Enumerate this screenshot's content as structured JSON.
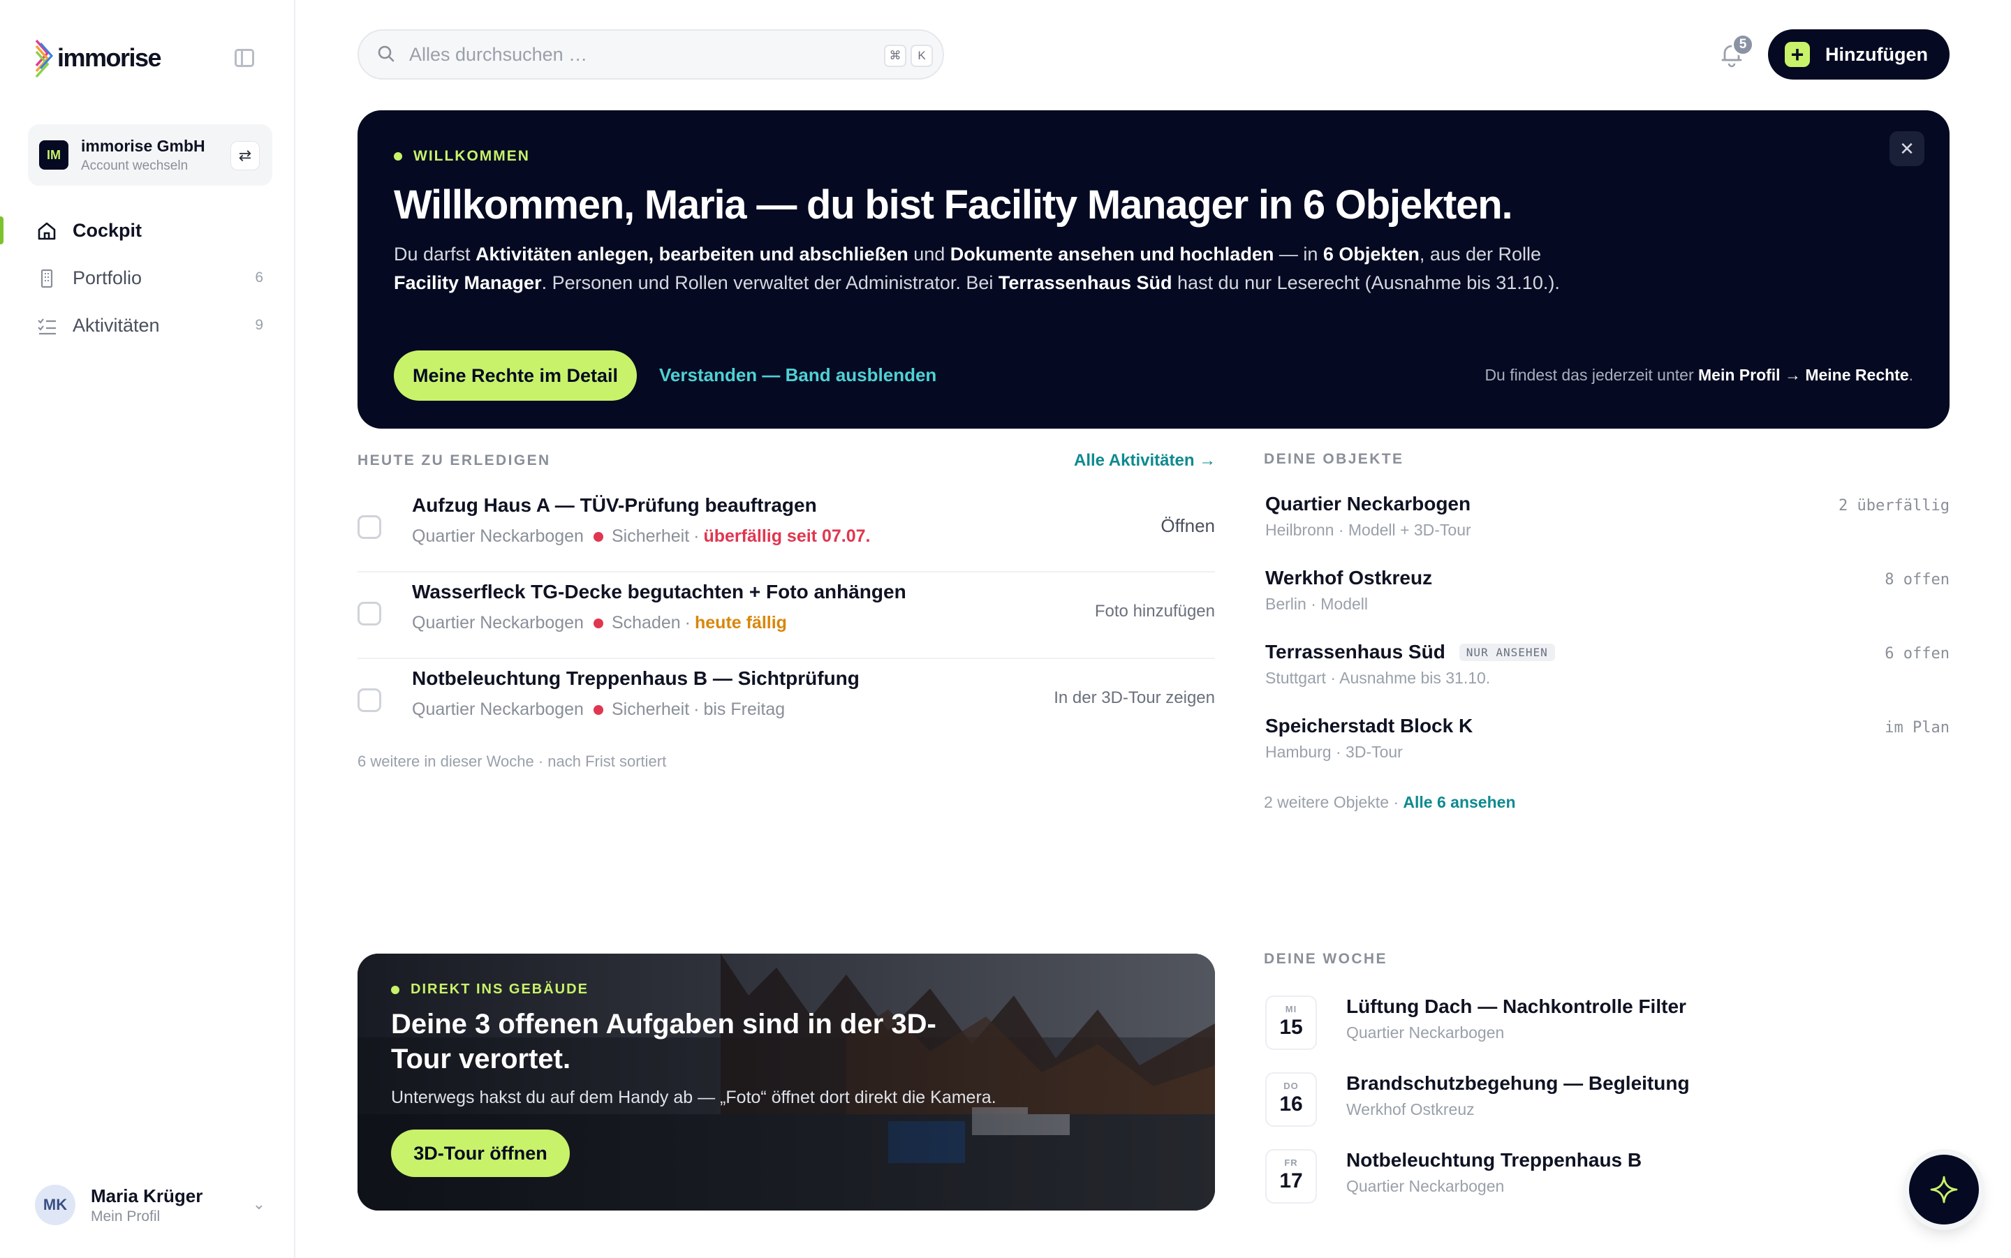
{
  "brand": {
    "name": "immorise"
  },
  "account": {
    "initials": "IM",
    "name": "immorise GmbH",
    "sub": "Account wechseln"
  },
  "nav": [
    {
      "label": "Cockpit",
      "count": ""
    },
    {
      "label": "Portfolio",
      "count": "6"
    },
    {
      "label": "Aktivitäten",
      "count": "9"
    }
  ],
  "user": {
    "initials": "MK",
    "name": "Maria Krüger",
    "sub": "Mein Profil"
  },
  "search": {
    "placeholder": "Alles durchsuchen …",
    "kbd_1": "⌘",
    "kbd_2": "K"
  },
  "notifications": {
    "count": "5"
  },
  "add_button": {
    "label": "Hinzufügen"
  },
  "banner": {
    "eyebrow": "WILLKOMMEN",
    "title": "Willkommen, Maria — du bist Facility Manager in 6 Objekten.",
    "text_1": "Du darfst ",
    "text_b1": "Aktivitäten anlegen, bearbeiten und abschließen",
    "text_2": " und ",
    "text_b2": "Dokumente ansehen und hochladen",
    "text_3": " — in ",
    "text_b3": "6 Objekten",
    "text_4": ", aus der Rolle ",
    "text_b4": "Facility Manager",
    "text_5": ". Personen und Rollen verwaltet der Administrator. Bei ",
    "text_b5": "Terrassenhaus Süd",
    "text_6": " hast du nur Leserecht (Ausnahme bis 31.10.).",
    "primary_button": "Meine Rechte im Detail",
    "dismiss_link": "Verstanden — Band ausblenden",
    "hint_prefix": "Du findest das jederzeit unter ",
    "hint_path": "Mein Profil → Meine Rechte",
    "hint_suffix": "."
  },
  "today": {
    "label": "HEUTE ZU ERLEDIGEN",
    "link": "Alle Aktivitäten →",
    "tasks": [
      {
        "title": "Aufzug Haus A — TÜV-Prüfung beauftragen",
        "object": "Quartier Neckarbogen",
        "category": "Sicherheit",
        "due": "überfällig seit 07.07.",
        "action": "Öffnen"
      },
      {
        "title": "Wasserfleck TG-Decke begutachten + Foto anhängen",
        "object": "Quartier Neckarbogen",
        "category": "Schaden",
        "due": "heute fällig",
        "action": "Foto hinzufügen"
      },
      {
        "title": "Notbeleuchtung Treppenhaus B — Sichtprüfung",
        "object": "Quartier Neckarbogen",
        "category": "Sicherheit",
        "due": "bis Freitag",
        "action": "In der 3D-Tour zeigen"
      }
    ],
    "footer": "6 weitere in dieser Woche · nach Frist sortiert"
  },
  "objects": {
    "label": "DEINE OBJEKTE",
    "items": [
      {
        "name": "Quartier Neckarbogen",
        "tag": "",
        "sub": "Heilbronn · Modell + 3D-Tour",
        "stat": "2 überfällig"
      },
      {
        "name": "Werkhof Ostkreuz",
        "tag": "",
        "sub": "Berlin · Modell",
        "stat": "8 offen"
      },
      {
        "name": "Terrassenhaus Süd",
        "tag": "NUR ANSEHEN",
        "sub": "Stuttgart · Ausnahme bis 31.10.",
        "stat": "6 offen"
      },
      {
        "name": "Speicherstadt Block K",
        "tag": "",
        "sub": "Hamburg · 3D-Tour",
        "stat": "im Plan"
      }
    ],
    "footer_text": "2 weitere Objekte · ",
    "footer_link": "Alle 6 ansehen"
  },
  "tour": {
    "eyebrow": "DIREKT INS GEBÄUDE",
    "title": "Deine 3 offenen Aufgaben sind in der 3D-Tour verortet.",
    "text": "Unterwegs hakst du auf dem Handy ab — „Foto“ öffnet dort direkt die Kamera.",
    "button": "3D-Tour öffnen"
  },
  "week": {
    "label": "DEINE WOCHE",
    "events": [
      {
        "dow": "MI",
        "day": "15",
        "title": "Lüftung Dach — Nachkontrolle Filter",
        "object": "Quartier Neckarbogen"
      },
      {
        "dow": "DO",
        "day": "16",
        "title": "Brandschutzbegehung — Begleitung",
        "object": "Werkhof Ostkreuz"
      },
      {
        "dow": "FR",
        "day": "17",
        "title": "Notbeleuchtung Treppenhaus B",
        "object": "Quartier Neckarbogen"
      }
    ]
  },
  "colors": {
    "navy": "#050a22",
    "lime": "#c8f26a",
    "teal": "#0e8a8f",
    "red": "#e0364f",
    "orange": "#d9860b"
  }
}
